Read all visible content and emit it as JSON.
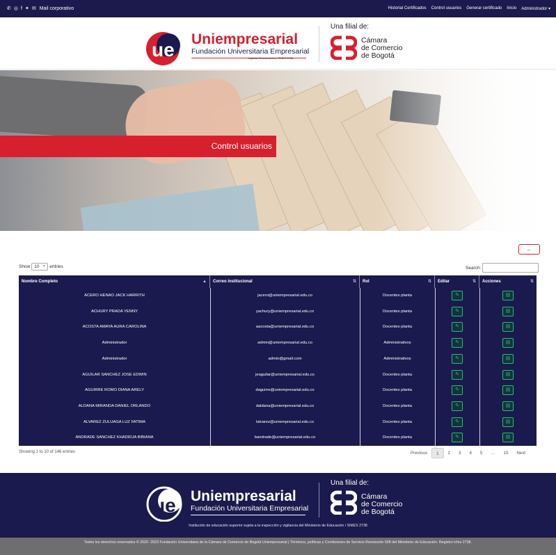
{
  "topbar": {
    "social_icons": [
      "whatsapp-icon",
      "instagram-icon",
      "facebook-icon",
      "twitter-icon",
      "mail-icon"
    ],
    "mail_label": "Mail corporativo",
    "nav": [
      "Historial Certificados",
      "Control usuarios",
      "Generar certificado",
      "Inicio",
      "Administrador ▾"
    ]
  },
  "header": {
    "brand_name": "Uniempresarial",
    "brand_sub": "Fundación Universitaria Empresarial",
    "brand_tiny": "Vigilada Mineducación | SNIES 2738",
    "filial": "Una filial de:",
    "ccb_lines": [
      "Cámara",
      "de Comercio",
      "de Bogotá"
    ]
  },
  "hero": {
    "banner": "Control usuarios"
  },
  "toolbar": {
    "back": "←",
    "show_pre": "Show",
    "page_size": "10",
    "show_post": "entries",
    "search_label": "Search:"
  },
  "table": {
    "headers": [
      "Nombre Completo",
      "Correo institucional",
      "Rol",
      "Editar",
      "Acciones"
    ],
    "rows": [
      {
        "name": "ACERO HENAO JACK HARRITH",
        "email": "jacero@uniempresarial.edu.co",
        "rol": "Docentes planta"
      },
      {
        "name": "ACHURY PRADA YENNY",
        "email": "yachury@uniempresarial.edu.co",
        "rol": "Docentes planta"
      },
      {
        "name": "ACOSTA AMAYA AURA CAROLINA",
        "email": "aacosta@uniempresarial.edu.co",
        "rol": "Docentes planta"
      },
      {
        "name": "Administrador",
        "email": "admin@uniempresarial.edu.co",
        "rol": "Administrativos"
      },
      {
        "name": "Administrador",
        "email": "admin@gmail.com",
        "rol": "Administrativos"
      },
      {
        "name": "AGUILAR SANCHEZ JOSE EDWIN",
        "email": "jeaguilar@uniempresarial.edu.co",
        "rol": "Docentes planta"
      },
      {
        "name": "AGUIRRE ROMO DIANA ARELY",
        "email": "daguirre@uniempresarial.edu.co",
        "rol": "Docentes planta"
      },
      {
        "name": "ALDANA MIRANDA DANIEL ORLANDO",
        "email": "daldana@uniempresarial.edu.co",
        "rol": "Docentes planta"
      },
      {
        "name": "ALVAREZ ZULUAGA LUZ FATIMA",
        "email": "lalvarez@uniempresarial.edu.co",
        "rol": "Docentes planta"
      },
      {
        "name": "ANDRADE SANCHEZ KHADIDJA BIBIANA",
        "email": "bandrade@uniempresarial.edu.co",
        "rol": "Docentes planta"
      }
    ],
    "edit_icon": "pencil-icon",
    "action_icon": "document-icon"
  },
  "info": "Showing 1 to 10 of 146 entries",
  "pager": [
    "Previous",
    "1",
    "2",
    "3",
    "4",
    "5",
    "…",
    "15",
    "Next"
  ],
  "footer": {
    "brand_name": "Uniempresarial",
    "brand_sub": "Fundación Universitaria Empresarial",
    "filial": "Una filial de:",
    "ccb_lines": [
      "Cámara",
      "de Comercio",
      "de Bogotá"
    ],
    "institution": "Institución de educación superior sujeta a la inspección y vigilancia del Ministerio de Educación / SNIES 2738",
    "copyright": "Todos los derechos reservados © 2020 -2023 Fundación Universitaria de la Cámara de Comercio de Bogotá Uniempresarial | Términos, políticas y Condiciones de Servicio Resolución 598 del Ministerio de Educación. Registro Icfes 2738."
  },
  "colors": {
    "navy": "#1b1a4e",
    "red": "#d7202e",
    "green": "#2dbd6e",
    "gray": "#6e6e70"
  }
}
